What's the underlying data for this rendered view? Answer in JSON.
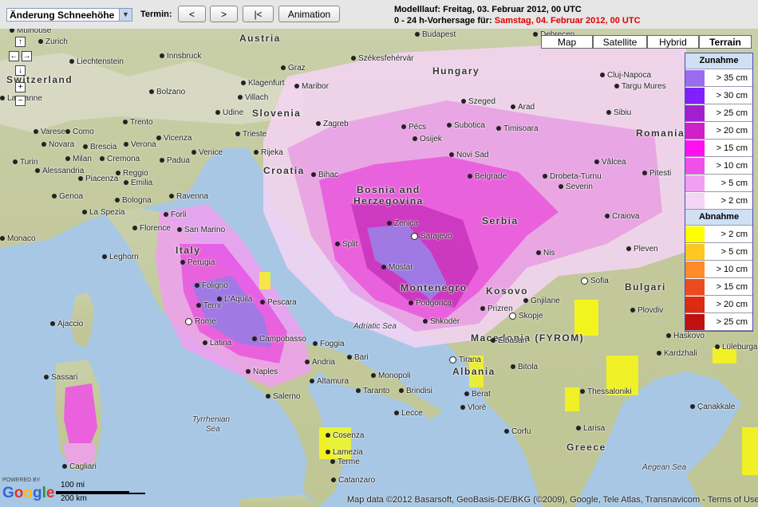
{
  "toolbar": {
    "select_value": "Änderung Schneehöhe",
    "termin_label": "Termin:",
    "btn_prev": "<",
    "btn_next": ">",
    "btn_first": "|<",
    "btn_animation": "Animation",
    "modelllauf": "Modelllauf: Freitag, 03. Februar 2012, 00 UTC",
    "forecast_prefix": "0 - 24 h-Vorhersage für:",
    "forecast_date": "Samstag, 04. Februar 2012, 00 UTC"
  },
  "map_types": [
    "Map",
    "Satellite",
    "Hybrid",
    "Terrain"
  ],
  "map_type_active": "Terrain",
  "legend": {
    "zunahme_title": "Zunahme",
    "zunahme": [
      {
        "label": "> 35 cm",
        "color": "#9a6cf0"
      },
      {
        "label": "> 30 cm",
        "color": "#8020ff"
      },
      {
        "label": "> 25 cm",
        "color": "#a020d0"
      },
      {
        "label": "> 20 cm",
        "color": "#d020c8"
      },
      {
        "label": "> 15 cm",
        "color": "#ff10f0"
      },
      {
        "label": "> 10 cm",
        "color": "#f050e8"
      },
      {
        "label": "> 5 cm",
        "color": "#f0a0f0"
      },
      {
        "label": "> 2 cm",
        "color": "#f5d5f5"
      }
    ],
    "abnahme_title": "Abnahme",
    "abnahme": [
      {
        "label": "> 2 cm",
        "color": "#ffff00"
      },
      {
        "label": "> 5 cm",
        "color": "#ffc820"
      },
      {
        "label": "> 10 cm",
        "color": "#ff8c28"
      },
      {
        "label": "> 15 cm",
        "color": "#ee4a20"
      },
      {
        "label": "> 20 cm",
        "color": "#dd2a10"
      },
      {
        "label": "> 25 cm",
        "color": "#c01010"
      }
    ]
  },
  "labels": {
    "austria": "Austria",
    "hungary": "Hungary",
    "switzerland": "Switzerland",
    "slovenia": "Slovenia",
    "croatia": "Croatia",
    "bosnia1": "Bosnia and",
    "bosnia2": "Herzegovina",
    "serbia": "Serbia",
    "romania": "Romania",
    "montenegro": "Montenegro",
    "kosovo": "Kosovo",
    "bulgaria": "Bulgari",
    "macedonia": "Macedonia (FYROM)",
    "albania": "Albania",
    "italy": "Italy",
    "greece": "Greece",
    "adriatic": "Adriatic Sea",
    "tyrrhenian1": "Tyrrhenian",
    "tyrrhenian2": "Sea",
    "aegean": "Aegean Sea",
    "mulhouse": "Mulhouse",
    "zurich": "Zurich",
    "liechtenstein": "Liechtenstein",
    "lausanne": "Lausanne",
    "innsbruck": "Innsbruck",
    "bolzano": "Bolzano",
    "trento": "Trento",
    "udine": "Udine",
    "trieste": "Trieste",
    "villach": "Villach",
    "klagenfurt": "Klagenfurt",
    "maribor": "Maribor",
    "graz": "Graz",
    "budapest": "Budapest",
    "szekes": "Székesfehérvár",
    "debrecen": "Debrecen",
    "szeged": "Szeged",
    "arad": "Arad",
    "cluj": "Cluj-Napoca",
    "targu": "Targu Mures",
    "sibiu": "Sibiu",
    "zagreb": "Zagreb",
    "pecs": "Pécs",
    "osijek": "Osijek",
    "subotica": "Subotica",
    "timisoara": "Timisoara",
    "novisad": "Novi Sad",
    "belgrade": "Belgrade",
    "drobeta": "Drobeta-Turnu",
    "severin": "Severin",
    "valcea": "Vâlcea",
    "pitesti": "Pitesti",
    "craiova": "Craiova",
    "varese": "Varese",
    "como": "Como",
    "novara": "Novara",
    "brescia": "Brescia",
    "verona": "Verona",
    "vicenza": "Vicenza",
    "venice": "Venice",
    "turin": "Turin",
    "milan": "Milan",
    "cremona": "Cremona",
    "padua": "Padua",
    "alessandria": "Alessandria",
    "piacenza": "Piacenza",
    "reggio": "Reggio",
    "emilia": "Emilia",
    "genoa": "Genoa",
    "bologna": "Bologna",
    "ravenna": "Ravenna",
    "laspezia": "La Spezia",
    "rijeka": "Rijeka",
    "bihac": "Bihac",
    "monaco": "Monaco",
    "florence": "Florence",
    "sanmarino": "San Marino",
    "forli": "Forli",
    "leghorn": "Leghorn",
    "perugia": "Perugia",
    "foligno": "Foligno",
    "terni": "Terni",
    "laquila": "L'Aquila",
    "pescara": "Pescara",
    "rome": "Rome",
    "latina": "Latina",
    "campobasso": "Campobasso",
    "naples": "Naples",
    "salerno": "Salerno",
    "foggia": "Foggia",
    "bari": "Bari",
    "andria": "Andria",
    "monopoli": "Monopoli",
    "altamura": "Altamura",
    "taranto": "Taranto",
    "brindisi": "Brindisi",
    "lecce": "Lecce",
    "split": "Split",
    "zenica": "Zenica",
    "sarajevo": "Sarajevo",
    "mostar": "Mostar",
    "podgorica": "Podgorica",
    "shkoder": "Shkodër",
    "tirana": "Tirana",
    "elbasan": "Elbasan",
    "berat": "Berat",
    "vlore": "Vlorë",
    "skopje": "Skopje",
    "prizren": "Prizren",
    "gnjilane": "Gnjilane",
    "nis": "Nis",
    "sofia": "Sofia",
    "pleven": "Pleven",
    "plovdiv": "Plovdiv",
    "haskovo": "Haskovo",
    "kardzhali": "Kardzhali",
    "bitola": "Bitola",
    "thessaloniki": "Thessaloniki",
    "luleburgaz": "Lüleburgaz",
    "canakkale": "Çanakkale",
    "ajaccio": "Ajaccio",
    "sassari": "Sassari",
    "cagliari": "Cagliari",
    "lamezia": "Lamezia",
    "terme": "Terme",
    "catanzaro": "Catanzaro",
    "cosenza": "Cosenza",
    "corfu": "Corfu",
    "larisa": "Larisa"
  },
  "footer": {
    "copyright": "Map data ©2012 Basarsoft, GeoBasis-DE/BKG (©2009), Google, Tele Atlas, Transnavicom - Terms of Use",
    "scale_mi": "100 mi",
    "scale_km": "200 km",
    "powered_by": "POWERED BY",
    "google": "Google"
  }
}
